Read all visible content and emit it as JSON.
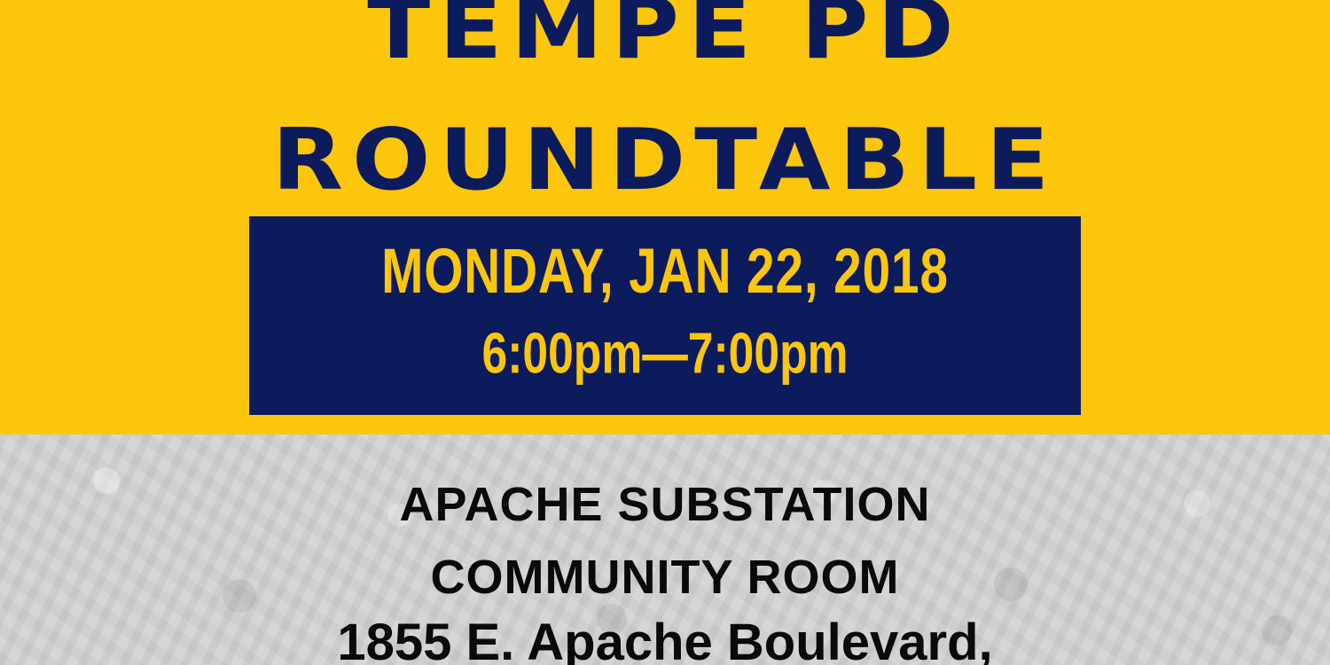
{
  "header": {
    "title_line_1": "TEMPE PD",
    "title_line_2": "ROUNDTABLE"
  },
  "event": {
    "date": "MONDAY, JAN 22, 2018",
    "time": "6:00pm—7:00pm"
  },
  "location": {
    "venue": "APACHE SUBSTATION",
    "room": "COMMUNITY ROOM",
    "address": "1855 E. Apache Boulevard,"
  },
  "colors": {
    "gold": "#fbc60c",
    "navy": "#0c1b5c",
    "text_dark": "#0a0a0a",
    "background_gray": "#cfcfcf"
  }
}
